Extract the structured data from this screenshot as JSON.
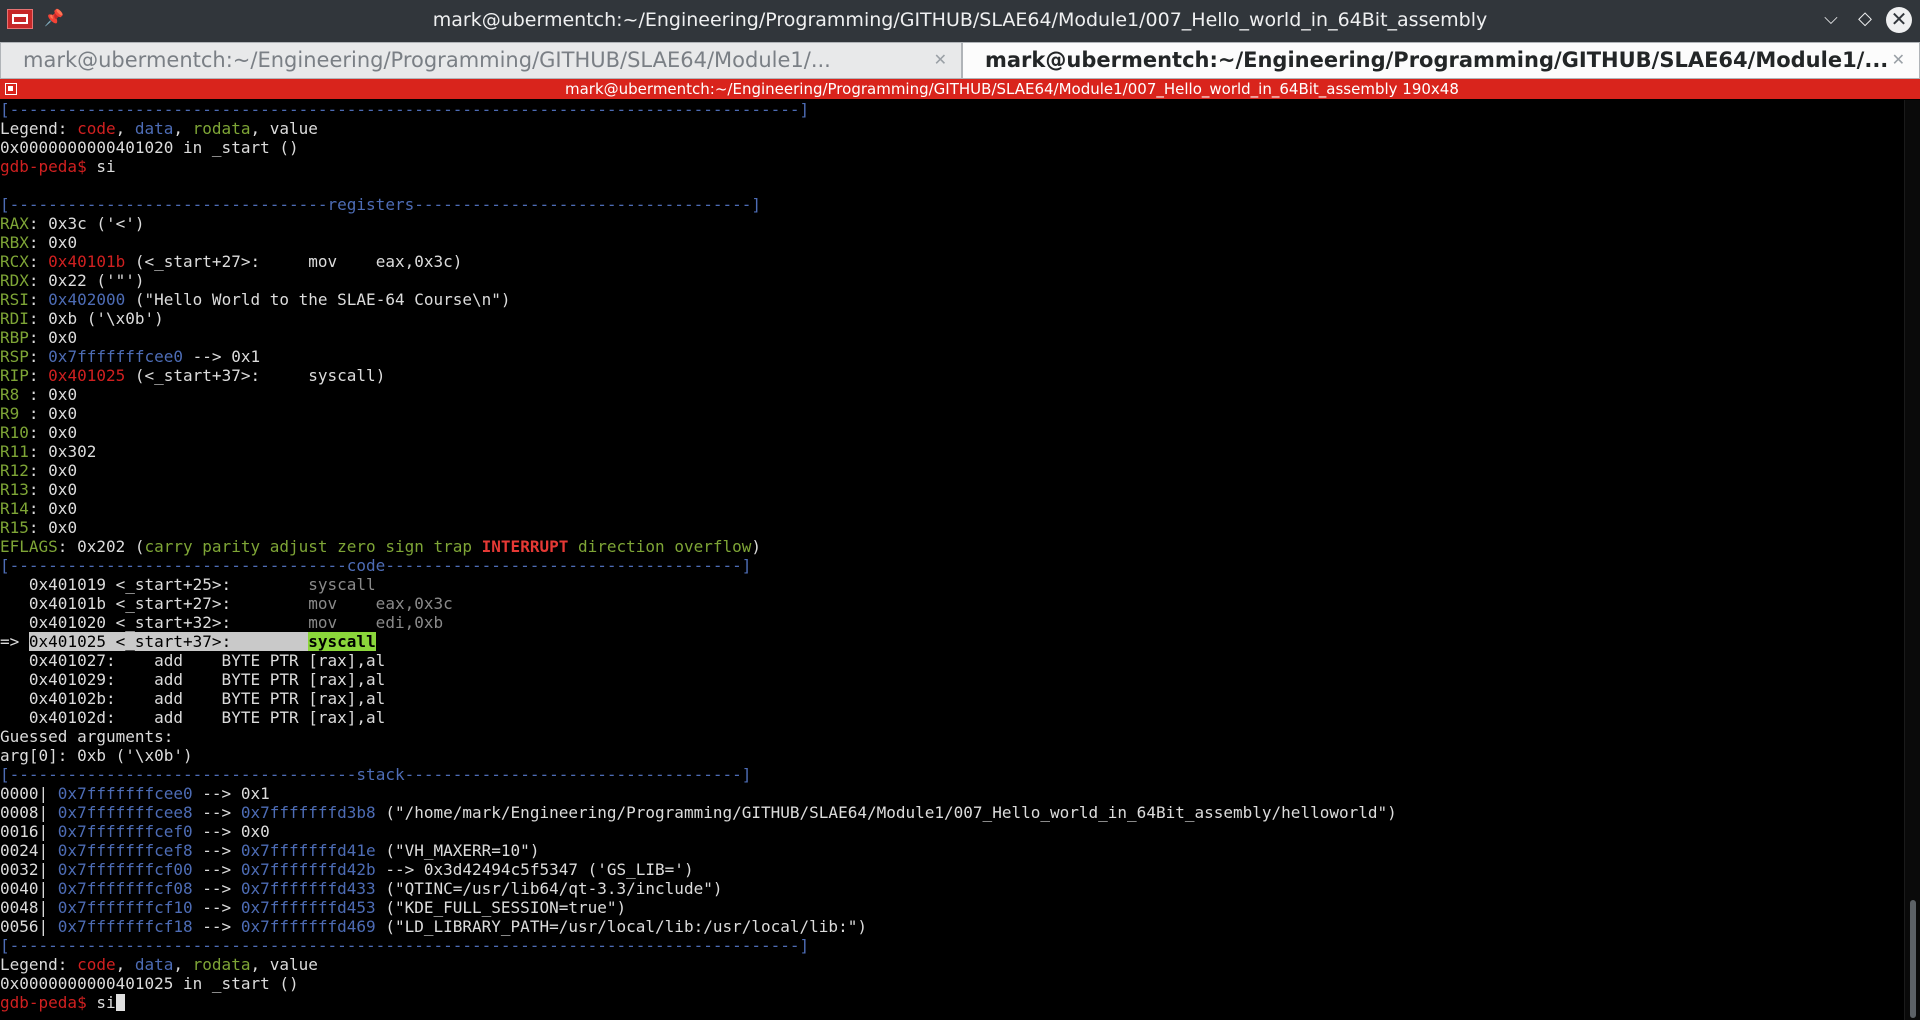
{
  "window": {
    "title": "mark@ubermentch:~/Engineering/Programming/GITHUB/SLAE64/Module1/007_Hello_world_in_64Bit_assembly",
    "pin_glyph": "📌",
    "min_glyph": "⌵",
    "max_glyph": "◇",
    "close_glyph": "✕"
  },
  "tabs": [
    {
      "label": "mark@ubermentch:~/Engineering/Programming/GITHUB/SLAE64/Module1/...",
      "close": "✕"
    },
    {
      "label": "mark@ubermentch:~/Engineering/Programming/GITHUB/SLAE64/Module1/...",
      "close": "✕"
    }
  ],
  "session": {
    "text": "mark@ubermentch:~/Engineering/Programming/GITHUB/SLAE64/Module1/007_Hello_world_in_64Bit_assembly 190x48"
  },
  "terminal": {
    "lines": [
      [
        {
          "t": "[----------------------------------------------------------------------------------]",
          "c": "c-blue"
        }
      ],
      [
        {
          "t": "Legend: "
        },
        {
          "t": "code",
          "c": "c-red"
        },
        {
          "t": ", "
        },
        {
          "t": "data",
          "c": "c-blue"
        },
        {
          "t": ", "
        },
        {
          "t": "rodata",
          "c": "c-green"
        },
        {
          "t": ", value"
        }
      ],
      [
        {
          "t": "0x0000000000401020 in _start ()"
        }
      ],
      [
        {
          "t": "gdb-peda$ ",
          "c": "c-red"
        },
        {
          "t": "si"
        }
      ],
      [
        {
          "t": ""
        }
      ],
      [
        {
          "t": "[---------------------------------",
          "c": "c-blue"
        },
        {
          "t": "registers",
          "c": "c-blue"
        },
        {
          "t": "-----------------------------------]",
          "c": "c-blue"
        }
      ],
      [
        {
          "t": "RAX",
          "c": "c-green"
        },
        {
          "t": ": 0x3c ('<')"
        }
      ],
      [
        {
          "t": "RBX",
          "c": "c-green"
        },
        {
          "t": ": 0x0"
        }
      ],
      [
        {
          "t": "RCX",
          "c": "c-green"
        },
        {
          "t": ": "
        },
        {
          "t": "0x40101b",
          "c": "c-red"
        },
        {
          "t": " (<_start+27>:     mov    eax,0x3c)"
        }
      ],
      [
        {
          "t": "RDX",
          "c": "c-green"
        },
        {
          "t": ": 0x22 ('\"')"
        }
      ],
      [
        {
          "t": "RSI",
          "c": "c-green"
        },
        {
          "t": ": "
        },
        {
          "t": "0x402000",
          "c": "c-blue"
        },
        {
          "t": " (\"Hello World to the SLAE-64 Course\\n\")"
        }
      ],
      [
        {
          "t": "RDI",
          "c": "c-green"
        },
        {
          "t": ": 0xb ('\\x0b')"
        }
      ],
      [
        {
          "t": "RBP",
          "c": "c-green"
        },
        {
          "t": ": 0x0"
        }
      ],
      [
        {
          "t": "RSP",
          "c": "c-green"
        },
        {
          "t": ": "
        },
        {
          "t": "0x7fffffffcee0",
          "c": "c-blue"
        },
        {
          "t": " --> 0x1"
        }
      ],
      [
        {
          "t": "RIP",
          "c": "c-green"
        },
        {
          "t": ": "
        },
        {
          "t": "0x401025",
          "c": "c-red"
        },
        {
          "t": " (<_start+37>:     syscall)"
        }
      ],
      [
        {
          "t": "R8 ",
          "c": "c-green"
        },
        {
          "t": ": 0x0"
        }
      ],
      [
        {
          "t": "R9 ",
          "c": "c-green"
        },
        {
          "t": ": 0x0"
        }
      ],
      [
        {
          "t": "R10",
          "c": "c-green"
        },
        {
          "t": ": 0x0"
        }
      ],
      [
        {
          "t": "R11",
          "c": "c-green"
        },
        {
          "t": ": 0x302"
        }
      ],
      [
        {
          "t": "R12",
          "c": "c-green"
        },
        {
          "t": ": 0x0"
        }
      ],
      [
        {
          "t": "R13",
          "c": "c-green"
        },
        {
          "t": ": 0x0"
        }
      ],
      [
        {
          "t": "R14",
          "c": "c-green"
        },
        {
          "t": ": 0x0"
        }
      ],
      [
        {
          "t": "R15",
          "c": "c-green"
        },
        {
          "t": ": 0x0"
        }
      ],
      [
        {
          "t": "EFLAGS",
          "c": "c-green"
        },
        {
          "t": ": 0x202 ("
        },
        {
          "t": "carry parity adjust zero sign trap ",
          "c": "c-green"
        },
        {
          "t": "INTERRUPT",
          "c": "c-int"
        },
        {
          "t": " direction overflow",
          "c": "c-green"
        },
        {
          "t": ")"
        }
      ],
      [
        {
          "t": "[-----------------------------------",
          "c": "c-blue"
        },
        {
          "t": "code",
          "c": "c-blue"
        },
        {
          "t": "-------------------------------------]",
          "c": "c-blue"
        }
      ],
      [
        {
          "t": "   0x401019 <_start+25>:        "
        },
        {
          "t": "syscall",
          "c": "c-grey"
        }
      ],
      [
        {
          "t": "   0x40101b <_start+27>:        "
        },
        {
          "t": "mov    eax,0x3c",
          "c": "c-grey"
        }
      ],
      [
        {
          "t": "   0x401020 <_start+32>:        "
        },
        {
          "t": "mov    edi,0xb",
          "c": "c-grey"
        }
      ],
      [
        {
          "t": "=> "
        },
        {
          "t": "0x401025 <_start+37>:        ",
          "c": "hl-cur"
        },
        {
          "t": "syscall",
          "c": "hl-sys"
        }
      ],
      [
        {
          "t": "   0x401027:    add    BYTE PTR [rax],al"
        }
      ],
      [
        {
          "t": "   0x401029:    add    BYTE PTR [rax],al"
        }
      ],
      [
        {
          "t": "   0x40102b:    add    BYTE PTR [rax],al"
        }
      ],
      [
        {
          "t": "   0x40102d:    add    BYTE PTR [rax],al"
        }
      ],
      [
        {
          "t": "Guessed arguments:"
        }
      ],
      [
        {
          "t": "arg[0]: 0xb ('\\x0b')"
        }
      ],
      [
        {
          "t": "[------------------------------------",
          "c": "c-blue"
        },
        {
          "t": "stack",
          "c": "c-blue"
        },
        {
          "t": "-----------------------------------]",
          "c": "c-blue"
        }
      ],
      [
        {
          "t": "0000| "
        },
        {
          "t": "0x7fffffffcee0",
          "c": "c-blue"
        },
        {
          "t": " --> 0x1"
        }
      ],
      [
        {
          "t": "0008| "
        },
        {
          "t": "0x7fffffffcee8",
          "c": "c-blue"
        },
        {
          "t": " --> "
        },
        {
          "t": "0x7fffffffd3b8",
          "c": "c-blue"
        },
        {
          "t": " (\"/home/mark/Engineering/Programming/GITHUB/SLAE64/Module1/007_Hello_world_in_64Bit_assembly/helloworld\")"
        }
      ],
      [
        {
          "t": "0016| "
        },
        {
          "t": "0x7fffffffcef0",
          "c": "c-blue"
        },
        {
          "t": " --> 0x0"
        }
      ],
      [
        {
          "t": "0024| "
        },
        {
          "t": "0x7fffffffcef8",
          "c": "c-blue"
        },
        {
          "t": " --> "
        },
        {
          "t": "0x7fffffffd41e",
          "c": "c-blue"
        },
        {
          "t": " (\"VH_MAXERR=10\")"
        }
      ],
      [
        {
          "t": "0032| "
        },
        {
          "t": "0x7fffffffcf00",
          "c": "c-blue"
        },
        {
          "t": " --> "
        },
        {
          "t": "0x7fffffffd42b",
          "c": "c-blue"
        },
        {
          "t": " --> 0x3d42494c5f5347 ('GS_LIB=')"
        }
      ],
      [
        {
          "t": "0040| "
        },
        {
          "t": "0x7fffffffcf08",
          "c": "c-blue"
        },
        {
          "t": " --> "
        },
        {
          "t": "0x7fffffffd433",
          "c": "c-blue"
        },
        {
          "t": " (\"QTINC=/usr/lib64/qt-3.3/include\")"
        }
      ],
      [
        {
          "t": "0048| "
        },
        {
          "t": "0x7fffffffcf10",
          "c": "c-blue"
        },
        {
          "t": " --> "
        },
        {
          "t": "0x7fffffffd453",
          "c": "c-blue"
        },
        {
          "t": " (\"KDE_FULL_SESSION=true\")"
        }
      ],
      [
        {
          "t": "0056| "
        },
        {
          "t": "0x7fffffffcf18",
          "c": "c-blue"
        },
        {
          "t": " --> "
        },
        {
          "t": "0x7fffffffd469",
          "c": "c-blue"
        },
        {
          "t": " (\"LD_LIBRARY_PATH=/usr/local/lib:/usr/local/lib:\")"
        }
      ],
      [
        {
          "t": "[----------------------------------------------------------------------------------]",
          "c": "c-blue"
        }
      ],
      [
        {
          "t": "Legend: "
        },
        {
          "t": "code",
          "c": "c-red"
        },
        {
          "t": ", "
        },
        {
          "t": "data",
          "c": "c-blue"
        },
        {
          "t": ", "
        },
        {
          "t": "rodata",
          "c": "c-green"
        },
        {
          "t": ", value"
        }
      ],
      [
        {
          "t": "0x0000000000401025 in _start ()"
        }
      ],
      [
        {
          "t": "gdb-peda$ ",
          "c": "c-red"
        },
        {
          "t": "si"
        },
        {
          "cursor": true
        }
      ]
    ]
  }
}
